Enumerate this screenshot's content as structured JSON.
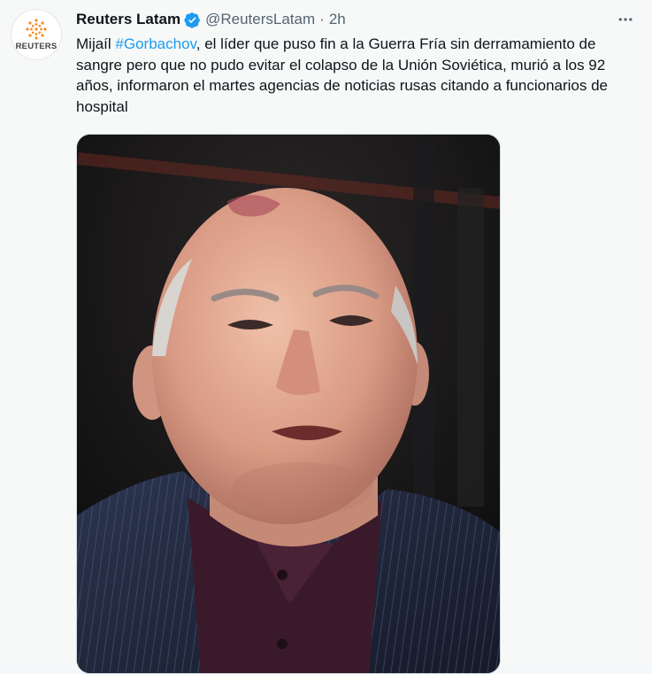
{
  "tweet": {
    "avatar": {
      "logo_text": "REUTERS",
      "icon": "reuters-logo-icon"
    },
    "author": {
      "name": "Reuters Latam",
      "handle": "@ReutersLatam",
      "separator": "·",
      "time": "2h",
      "verified_icon": "verified-badge-icon"
    },
    "more_icon": "more-horizontal-icon",
    "text": {
      "prefix": "Mijaíl ",
      "hashtag": "#Gorbachov",
      "body": ", el líder que puso fin a la Guerra Fría sin derramamiento de sangre pero que no pudo evitar el colapso de la Unión Soviética, murió a los 92 años, informaron el martes agencias de noticias rusas citando a funcionarios de hospital"
    },
    "media": {
      "type": "photo"
    }
  },
  "colors": {
    "link": "#1d9bf0",
    "secondary_text": "#536471",
    "verified": "#1d9bf0",
    "background": "#f7f9f9"
  }
}
